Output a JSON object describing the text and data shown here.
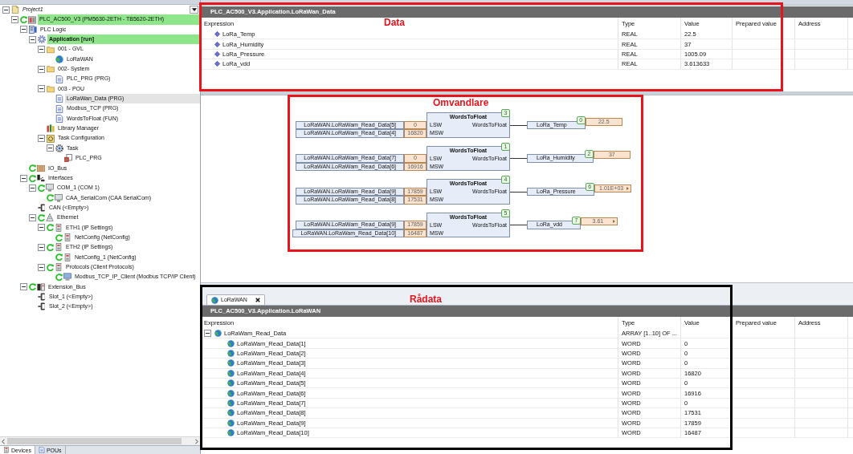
{
  "devices": {
    "tree": [
      {
        "label": "Project1",
        "kind": "project",
        "online": false,
        "active": false,
        "selected": false,
        "expanded": true,
        "children": [
          {
            "label": "PLC_AC500_V3 (PM5630-2ETH - TB5620-2ETH)",
            "kind": "plc",
            "online": true,
            "active": true,
            "selected": false,
            "expanded": true,
            "children": [
              {
                "label": "PLC Logic",
                "kind": "logic",
                "online": false,
                "active": false,
                "selected": false,
                "expanded": true,
                "children": [
                  {
                    "label": "Application [run]",
                    "kind": "application",
                    "online": false,
                    "active": true,
                    "selected": false,
                    "expanded": true,
                    "children": [
                      {
                        "label": "001 - GVL",
                        "kind": "folder",
                        "online": false,
                        "active": false,
                        "selected": false,
                        "expanded": true,
                        "children": [
                          {
                            "label": "LoRaWAN",
                            "kind": "globe",
                            "online": false,
                            "active": false,
                            "selected": false
                          }
                        ]
                      },
                      {
                        "label": "002- System",
                        "kind": "folder",
                        "online": false,
                        "active": false,
                        "selected": false,
                        "expanded": true,
                        "children": [
                          {
                            "label": "PLC_PRG (PRG)",
                            "kind": "pou",
                            "online": false,
                            "active": false,
                            "selected": false
                          }
                        ]
                      },
                      {
                        "label": "003 - POU",
                        "kind": "folder",
                        "online": false,
                        "active": false,
                        "selected": false,
                        "expanded": true,
                        "children": [
                          {
                            "label": "LoRaWan_Data (PRG)",
                            "kind": "pou",
                            "online": false,
                            "active": false,
                            "selected": true
                          },
                          {
                            "label": "Modbus_TCP (PRG)",
                            "kind": "pou",
                            "online": false,
                            "active": false,
                            "selected": false
                          },
                          {
                            "label": "WordsToFloat (FUN)",
                            "kind": "pou",
                            "online": false,
                            "active": false,
                            "selected": false
                          }
                        ]
                      },
                      {
                        "label": "Library Manager",
                        "kind": "library",
                        "online": false,
                        "active": false,
                        "selected": false
                      },
                      {
                        "label": "Task Configuration",
                        "kind": "taskconfig",
                        "online": false,
                        "active": false,
                        "selected": false,
                        "expanded": true,
                        "children": [
                          {
                            "label": "Task",
                            "kind": "task",
                            "online": false,
                            "active": false,
                            "selected": false,
                            "expanded": true,
                            "children": [
                              {
                                "label": "PLC_PRG",
                                "kind": "call",
                                "online": false,
                                "active": false,
                                "selected": false
                              }
                            ]
                          }
                        ]
                      }
                    ]
                  }
                ]
              },
              {
                "label": "IO_Bus",
                "kind": "bus",
                "online": true,
                "active": false,
                "selected": false
              },
              {
                "label": "Interfaces",
                "kind": "interfaces",
                "online": true,
                "active": false,
                "selected": false,
                "expanded": true,
                "children": [
                  {
                    "label": "COM_1 (COM 1)",
                    "kind": "serial",
                    "online": true,
                    "active": false,
                    "selected": false,
                    "expanded": true,
                    "children": [
                      {
                        "label": "CAA_SerialCom (CAA SerialCom)",
                        "kind": "serial",
                        "online": true,
                        "active": false,
                        "selected": false
                      }
                    ]
                  },
                  {
                    "label": "CAN (<Empty>)",
                    "kind": "slot",
                    "online": false,
                    "active": false,
                    "selected": false
                  },
                  {
                    "label": "Ethernet",
                    "kind": "ethernet",
                    "online": true,
                    "active": false,
                    "selected": false,
                    "expanded": true,
                    "children": [
                      {
                        "label": "ETH1 (IP Settings)",
                        "kind": "port",
                        "online": true,
                        "active": false,
                        "selected": false,
                        "expanded": true,
                        "children": [
                          {
                            "label": "NetConfig (NetConfig)",
                            "kind": "port",
                            "online": true,
                            "active": false,
                            "selected": false
                          }
                        ]
                      },
                      {
                        "label": "ETH2 (IP Settings)",
                        "kind": "port",
                        "online": true,
                        "active": false,
                        "selected": false,
                        "expanded": true,
                        "children": [
                          {
                            "label": "NetConfig_1 (NetConfig)",
                            "kind": "port",
                            "online": true,
                            "active": false,
                            "selected": false
                          }
                        ]
                      },
                      {
                        "label": "Protocols (Client Protocols)",
                        "kind": "port",
                        "online": true,
                        "active": false,
                        "selected": false,
                        "expanded": true,
                        "children": [
                          {
                            "label": "Modbus_TCP_IP_Client (Modbus TCP/IP Client)",
                            "kind": "client",
                            "online": true,
                            "active": false,
                            "selected": false
                          }
                        ]
                      }
                    ]
                  }
                ]
              },
              {
                "label": "Extension_Bus",
                "kind": "extbus",
                "online": true,
                "active": false,
                "selected": false,
                "expanded": true,
                "children": [
                  {
                    "label": "Slot_1 (<Empty>)",
                    "kind": "slot",
                    "online": false,
                    "active": false,
                    "selected": false
                  },
                  {
                    "label": "Slot_2 (<Empty>)",
                    "kind": "slot",
                    "online": false,
                    "active": false,
                    "selected": false
                  }
                ]
              }
            ]
          }
        ]
      }
    ],
    "tabs": [
      {
        "label": "Devices",
        "kind": "devices",
        "selected": true
      },
      {
        "label": "POUs",
        "kind": "pous",
        "selected": false
      }
    ]
  },
  "data_watch": {
    "title": "PLC_AC500_V3.Application.LoRaWan_Data",
    "columns": [
      "Expression",
      "Type",
      "Value",
      "Prepared value",
      "Address"
    ],
    "rows": [
      {
        "expression": "LoRa_Temp",
        "type": "REAL",
        "value": "22.5"
      },
      {
        "expression": "LoRa_Humidity",
        "type": "REAL",
        "value": "37"
      },
      {
        "expression": "LoRa_Pressure",
        "type": "REAL",
        "value": "1005.09"
      },
      {
        "expression": "LoRa_vdd",
        "type": "REAL",
        "value": "3.613633"
      }
    ]
  },
  "diagram": {
    "networks": [
      {
        "block": "WordsToFloat",
        "order": "3",
        "inputs": [
          {
            "pin": "LSW",
            "variable": "LoRaWAN.LoRaWam_Read_Data[5]",
            "value": "0"
          },
          {
            "pin": "MSW",
            "variable": "LoRaWAN.LoRaWam_Read_Data[4]",
            "value": "16820"
          }
        ],
        "output": {
          "pin": "WordsToFloat",
          "variable": "LoRa_Temp",
          "order": "0",
          "value": "22.5",
          "more": false
        }
      },
      {
        "block": "WordsToFloat",
        "order": "1",
        "inputs": [
          {
            "pin": "LSW",
            "variable": "LoRaWAN.LoRaWam_Read_Data[7]",
            "value": "0"
          },
          {
            "pin": "MSW",
            "variable": "LoRaWAN.LoRaWam_Read_Data[6]",
            "value": "16916"
          }
        ],
        "output": {
          "pin": "WordsToFloat",
          "variable": "LoRa_Humidity",
          "order": "2",
          "value": "37",
          "more": false
        }
      },
      {
        "block": "WordsToFloat",
        "order": "4",
        "inputs": [
          {
            "pin": "LSW",
            "variable": "LoRaWAN.LoRaWam_Read_Data[9]",
            "value": "17859"
          },
          {
            "pin": "MSW",
            "variable": "LoRaWAN.LoRaWam_Read_Data[8]",
            "value": "17531"
          }
        ],
        "output": {
          "pin": "WordsToFloat",
          "variable": "LoRa_Pressure",
          "order": "6",
          "value": "1.01E+03",
          "more": true
        }
      },
      {
        "block": "WordsToFloat",
        "order": "5",
        "inputs": [
          {
            "pin": "LSW",
            "variable": "LoRaWAN.LoRaWam_Read_Data[9]",
            "value": "17859"
          },
          {
            "pin": "MSW",
            "variable": "LoRaWAN.LoRaWam_Read_Data[10]",
            "value": "16487"
          }
        ],
        "output": {
          "pin": "WordsToFloat",
          "variable": "LoRa_vdd",
          "order": "7",
          "value": "3.61",
          "more": true
        }
      }
    ]
  },
  "raw_watch": {
    "tabs": [
      {
        "label": "LoRaWAN",
        "selected": true
      }
    ],
    "title": "PLC_AC500_V3.Application.LoRaWAN",
    "columns": [
      "Expression",
      "Type",
      "Value",
      "Prepared value",
      "Address"
    ],
    "rows": [
      {
        "expression": "LoRaWam_Read_Data",
        "type": "ARRAY [1..10] OF ...",
        "expanded": true,
        "children": [
          {
            "expression": "LoRaWam_Read_Data[1]",
            "type": "WORD",
            "value": "0"
          },
          {
            "expression": "LoRaWam_Read_Data[2]",
            "type": "WORD",
            "value": "0"
          },
          {
            "expression": "LoRaWam_Read_Data[3]",
            "type": "WORD",
            "value": "0"
          },
          {
            "expression": "LoRaWam_Read_Data[4]",
            "type": "WORD",
            "value": "16820"
          },
          {
            "expression": "LoRaWam_Read_Data[5]",
            "type": "WORD",
            "value": "0"
          },
          {
            "expression": "LoRaWam_Read_Data[6]",
            "type": "WORD",
            "value": "16916"
          },
          {
            "expression": "LoRaWam_Read_Data[7]",
            "type": "WORD",
            "value": "0"
          },
          {
            "expression": "LoRaWam_Read_Data[8]",
            "type": "WORD",
            "value": "17531"
          },
          {
            "expression": "LoRaWam_Read_Data[9]",
            "type": "WORD",
            "value": "17859"
          },
          {
            "expression": "LoRaWam_Read_Data[10]",
            "type": "WORD",
            "value": "16487"
          }
        ]
      }
    ]
  },
  "annotations": [
    {
      "label": "Data",
      "color": "#e8141c"
    },
    {
      "label": "Omvandlare",
      "color": "#e8141c"
    },
    {
      "label": "Rådata",
      "color": "#000000"
    }
  ]
}
